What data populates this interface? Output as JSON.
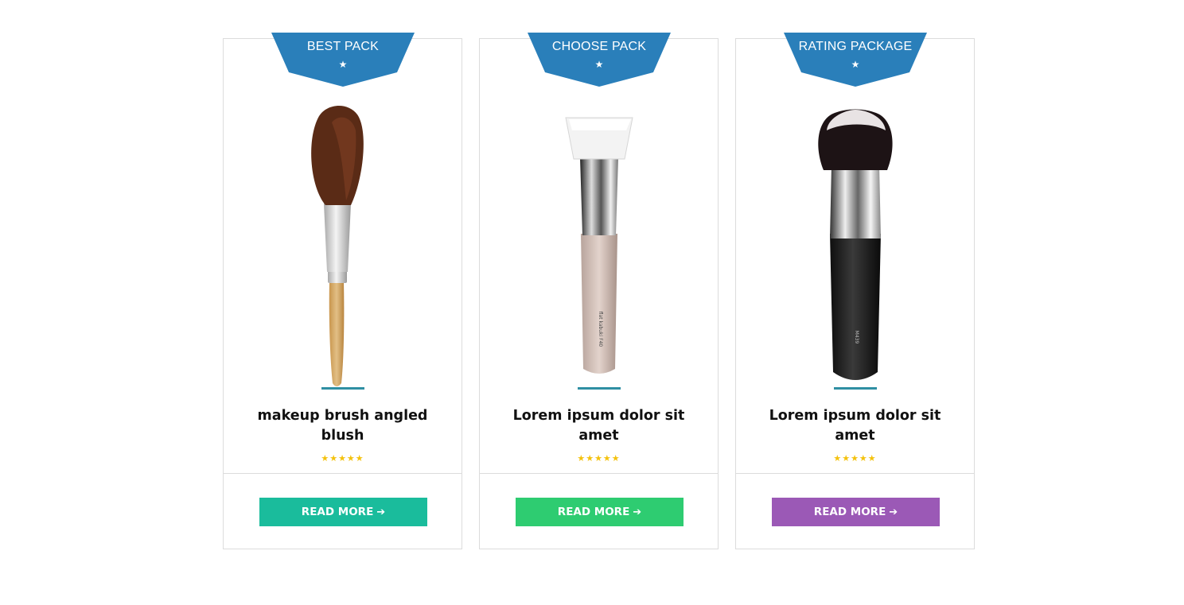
{
  "colors": {
    "ribbon": "#2a7fba",
    "divider": "#2f8fa3",
    "stars": "#f4c20d"
  },
  "cards": [
    {
      "ribbon": "BEST PACK",
      "ribbon_icon": "★",
      "title": "makeup brush angled blush",
      "rating": "★★★★★",
      "button": {
        "label": "READ MORE",
        "icon": "➔",
        "color": "#1abc9c"
      }
    },
    {
      "ribbon": "CHOOSE PACK",
      "ribbon_icon": "★",
      "title": "Lorem ipsum dolor sit amet",
      "rating": "★★★★★",
      "button": {
        "label": "READ MORE",
        "icon": "➔",
        "color": "#2ecc71"
      }
    },
    {
      "ribbon": "RATING PACKAGE",
      "ribbon_icon": "★",
      "title": "Lorem ipsum dolor sit amet",
      "rating": "★★★★★",
      "button": {
        "label": "READ MORE",
        "icon": "➔",
        "color": "#9b59b6"
      }
    }
  ]
}
